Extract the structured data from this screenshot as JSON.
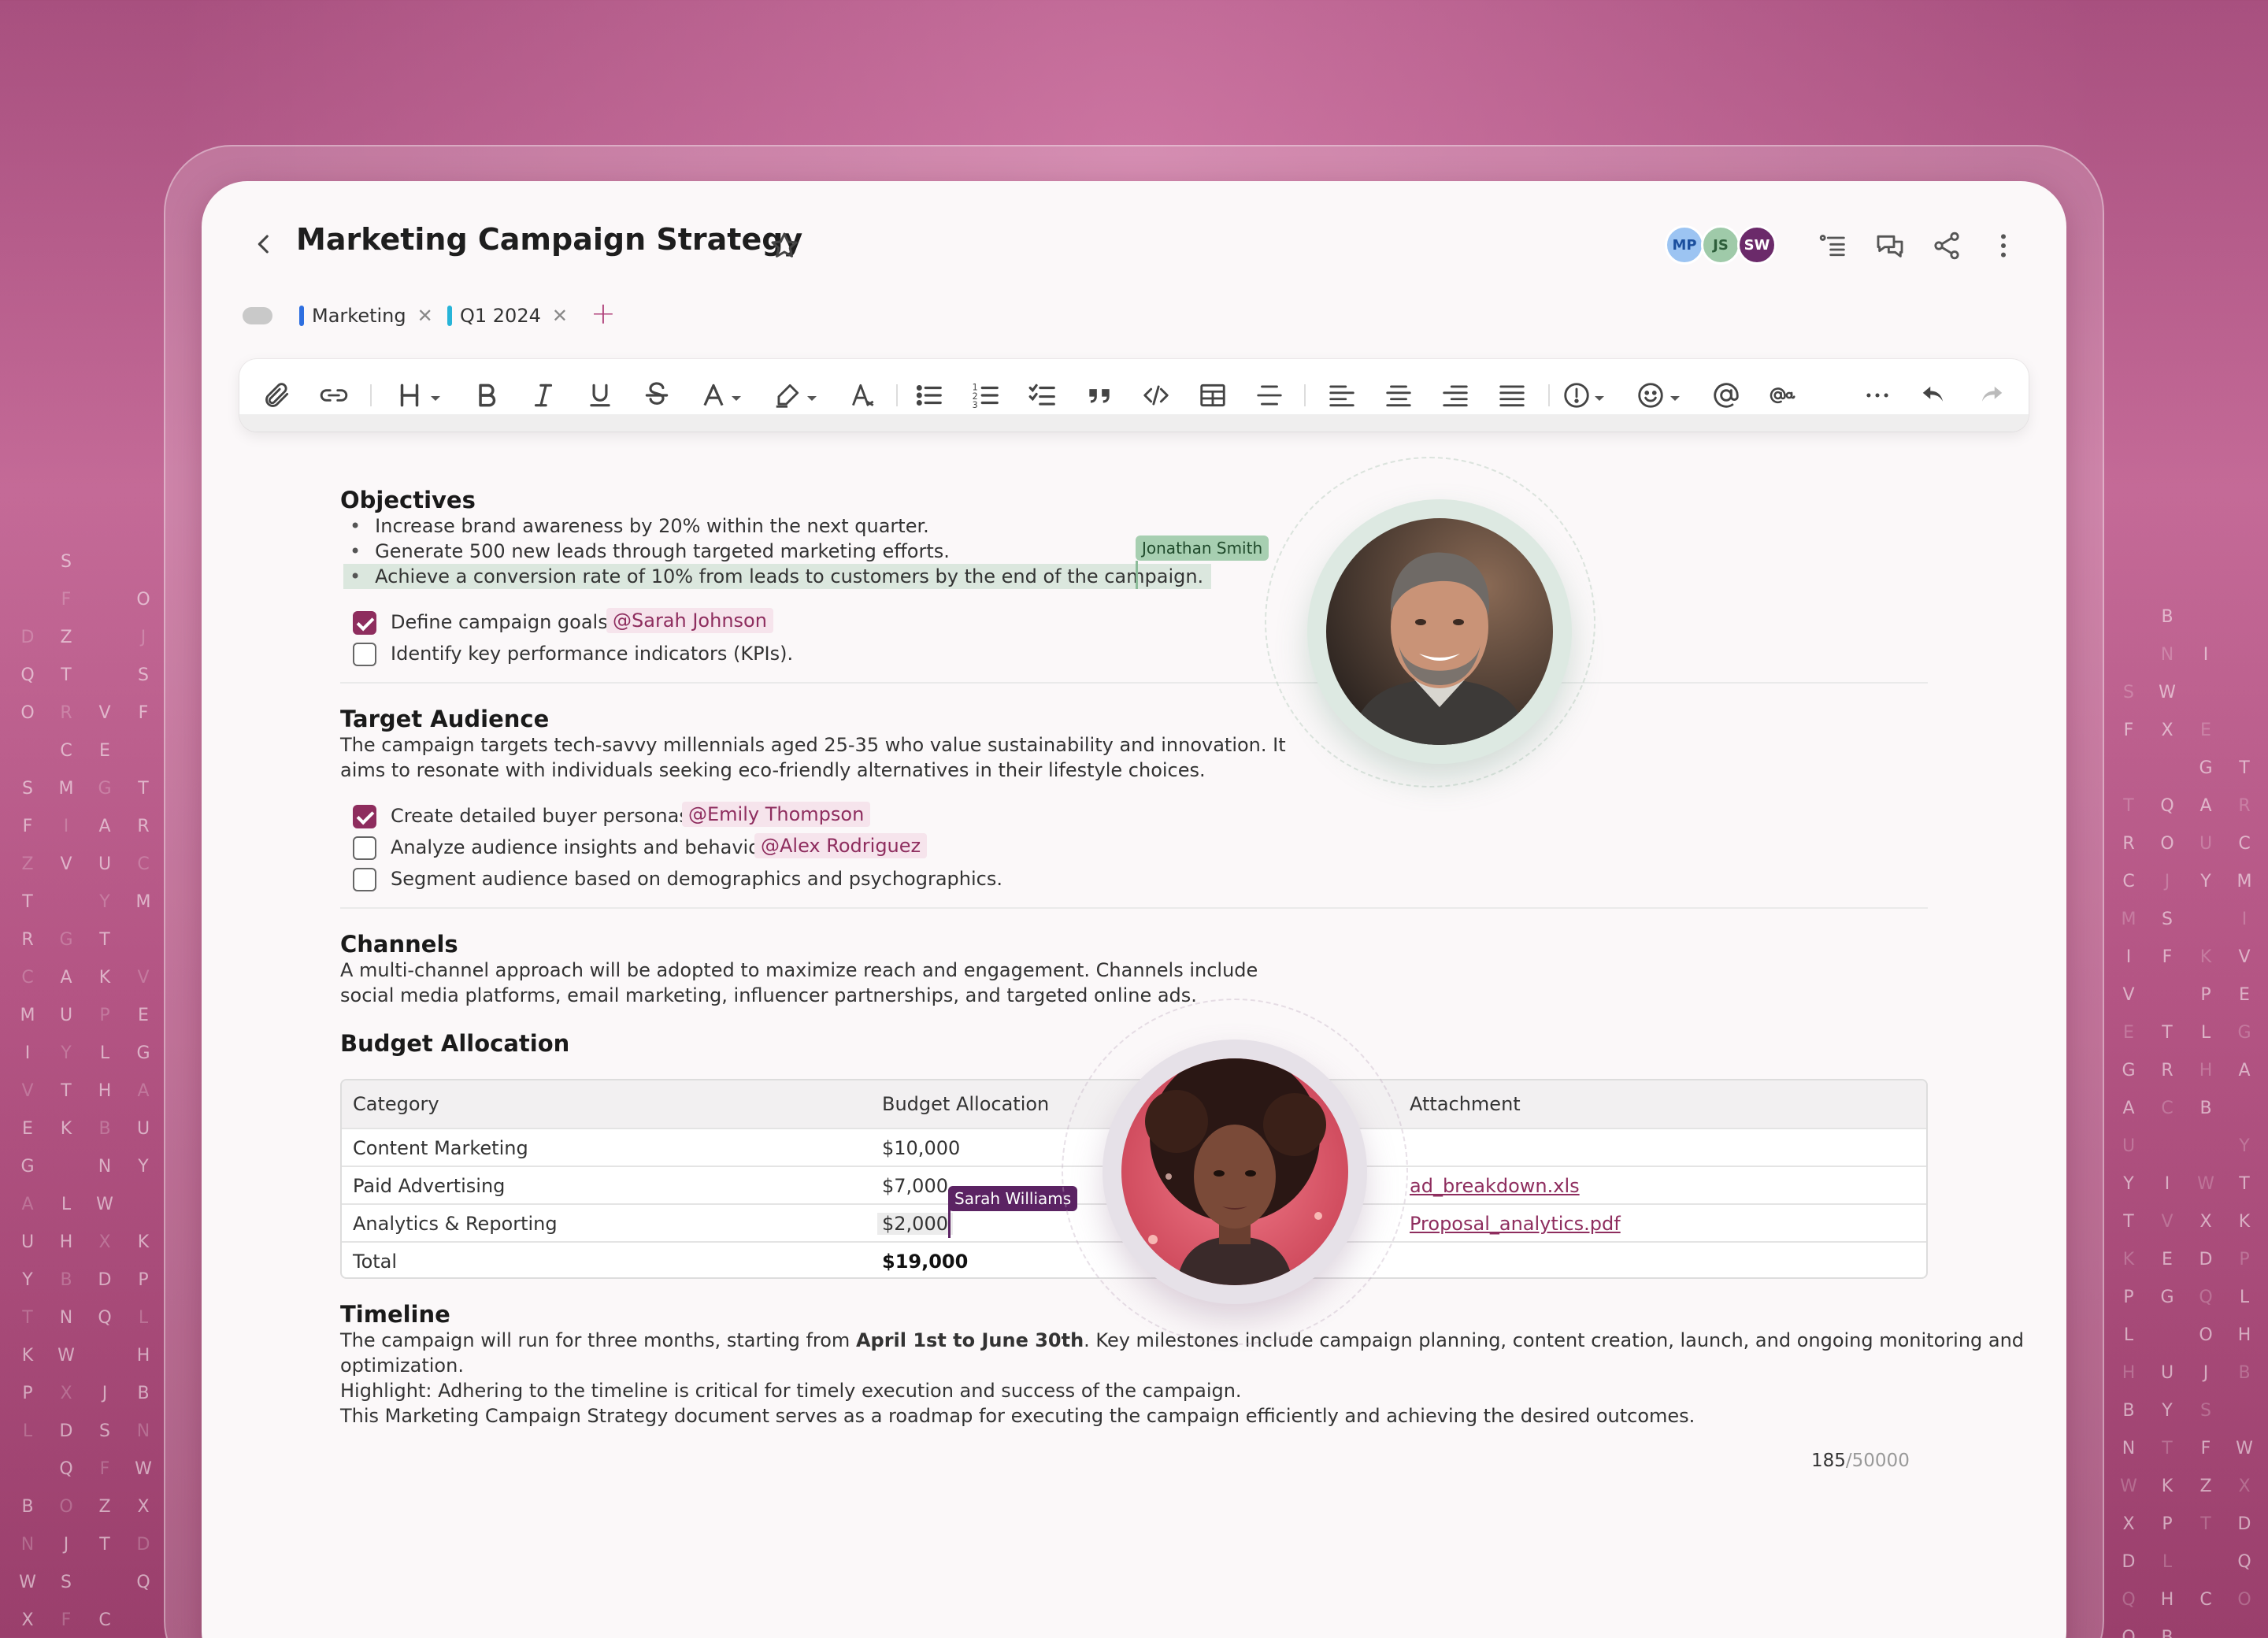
{
  "document": {
    "title": "Marketing Campaign Strategy",
    "collaborators": [
      "MP",
      "JS",
      "SW"
    ],
    "tags": [
      {
        "label": "Marketing",
        "color": "#2e6fe0"
      },
      {
        "label": "Q1 2024",
        "color": "#27b4d8"
      }
    ],
    "accent": "#8e2d5e"
  },
  "icons": {
    "back": "chevron-left-icon",
    "star": "star-icon",
    "outline": "outline-icon",
    "comments": "comments-icon",
    "share": "share-icon",
    "more": "more-vertical-icon"
  },
  "sections": {
    "objectives": {
      "title": "Objectives",
      "bullets": [
        "Increase brand awareness by 20% within the next quarter.",
        "Generate 500 new leads through targeted marketing efforts.",
        "Achieve a conversion rate of 10% from leads to customers by the end of the campaign."
      ],
      "cursor_user": "Jonathan Smith",
      "tasks": [
        {
          "text": "Define campaign goals.",
          "checked": true,
          "mention": "@Sarah Johnson"
        },
        {
          "text": "Identify key performance indicators (KPIs).",
          "checked": false,
          "mention": ""
        }
      ]
    },
    "audience": {
      "title": "Target Audience",
      "line1": "The campaign targets tech-savvy millennials aged 25-35 who value sustainability and innovation. It",
      "line2": "aims to resonate with individuals seeking eco-friendly alternatives in their lifestyle choices.",
      "tasks": [
        {
          "text": "Create detailed buyer personas.",
          "checked": true,
          "mention": "@Emily Thompson"
        },
        {
          "text": "Analyze audience insights and behavior.",
          "checked": false,
          "mention": "@Alex Rodriguez"
        },
        {
          "text": "Segment audience based on demographics and psychographics.",
          "checked": false,
          "mention": ""
        }
      ]
    },
    "channels": {
      "title": "Channels",
      "line1": "A multi-channel approach will be adopted to maximize reach and engagement. Channels include",
      "line2": "social media platforms, email marketing, influencer partnerships, and targeted online ads."
    },
    "budget": {
      "title": "Budget Allocation",
      "columns": [
        "Category",
        "Budget Allocation",
        "Attachment"
      ],
      "rows": [
        {
          "category": "Content Marketing",
          "amount": "$10,000",
          "attachment": ""
        },
        {
          "category": "Paid Advertising",
          "amount": "$7,000",
          "attachment": "ad_breakdown.xls"
        },
        {
          "category": "Analytics & Reporting",
          "amount": "$2,000",
          "attachment": "Proposal_analytics.pdf"
        },
        {
          "category": "Total",
          "amount": "$19,000",
          "attachment": ""
        }
      ],
      "cursor_user": "Sarah Williams"
    },
    "timeline": {
      "title": "Timeline",
      "line1_pre": "The campaign will run for three months, starting from ",
      "line1_bold": "April 1st to June 30th",
      "line1_post": ". Key milestones include campaign planning, content creation, launch, and ongoing monitoring and",
      "line2": "optimization.",
      "line3": "Highlight: Adhering to the timeline is critical for timely execution and success of the campaign.",
      "line4": "This Marketing Campaign Strategy document serves as a roadmap for executing the campaign efficiently and achieving the desired outcomes."
    }
  },
  "counter": {
    "current": "185",
    "max": "/50000"
  },
  "background_letters": {
    "left": [
      [
        "",
        "S",
        "",
        ""
      ],
      [
        "",
        "F",
        "",
        "O"
      ],
      [
        "D",
        "Z",
        "",
        "J"
      ],
      [
        "Q",
        "T",
        "",
        "S"
      ],
      [
        "O",
        "R",
        "V",
        "F"
      ],
      [
        "",
        "C",
        "E",
        ""
      ],
      [
        "S",
        "M",
        "G",
        "T"
      ],
      [
        "F",
        "I",
        "A",
        "R"
      ],
      [
        "Z",
        "V",
        "U",
        "C"
      ],
      [
        "T",
        "",
        "Y",
        "M"
      ],
      [
        "R",
        "G",
        "T",
        ""
      ],
      [
        "C",
        "A",
        "K",
        "V"
      ],
      [
        "M",
        "U",
        "P",
        "E"
      ],
      [
        "I",
        "Y",
        "L",
        "G"
      ],
      [
        "V",
        "T",
        "H",
        "A"
      ],
      [
        "E",
        "K",
        "B",
        "U"
      ],
      [
        "G",
        "",
        "N",
        "Y"
      ],
      [
        "A",
        "L",
        "W",
        ""
      ],
      [
        "U",
        "H",
        "X",
        "K"
      ],
      [
        "Y",
        "B",
        "D",
        "P"
      ],
      [
        "T",
        "N",
        "Q",
        "L"
      ],
      [
        "K",
        "W",
        "",
        "H"
      ],
      [
        "P",
        "X",
        "J",
        "B"
      ],
      [
        "L",
        "D",
        "S",
        "N"
      ],
      [
        "",
        "Q",
        "F",
        "W"
      ],
      [
        "B",
        "O",
        "Z",
        "X"
      ],
      [
        "N",
        "J",
        "T",
        "D"
      ],
      [
        "W",
        "S",
        "",
        "Q"
      ],
      [
        "X",
        "F",
        "C",
        ""
      ]
    ],
    "right": [
      [
        "",
        "B",
        "",
        ""
      ],
      [
        "",
        "N",
        "I",
        ""
      ],
      [
        "S",
        "W",
        "",
        ""
      ],
      [
        "F",
        "X",
        "E",
        ""
      ],
      [
        "",
        "",
        "G",
        "T"
      ],
      [
        "T",
        "Q",
        "A",
        "R"
      ],
      [
        "R",
        "O",
        "U",
        "C"
      ],
      [
        "C",
        "J",
        "Y",
        "M"
      ],
      [
        "M",
        "S",
        "",
        "I"
      ],
      [
        "I",
        "F",
        "K",
        "V"
      ],
      [
        "V",
        "",
        "P",
        "E"
      ],
      [
        "E",
        "T",
        "L",
        "G"
      ],
      [
        "G",
        "R",
        "H",
        "A"
      ],
      [
        "A",
        "C",
        "B",
        ""
      ],
      [
        "U",
        "",
        "",
        "Y"
      ],
      [
        "Y",
        "I",
        "W",
        "T"
      ],
      [
        "T",
        "V",
        "X",
        "K"
      ],
      [
        "K",
        "E",
        "D",
        "P"
      ],
      [
        "P",
        "G",
        "Q",
        "L"
      ],
      [
        "L",
        "",
        "O",
        "H"
      ],
      [
        "H",
        "U",
        "J",
        "B"
      ],
      [
        "B",
        "Y",
        "S",
        ""
      ],
      [
        "N",
        "T",
        "F",
        "W"
      ],
      [
        "W",
        "K",
        "Z",
        "X"
      ],
      [
        "X",
        "P",
        "T",
        "D"
      ],
      [
        "D",
        "L",
        "",
        "Q"
      ],
      [
        "Q",
        "H",
        "C",
        "O"
      ],
      [
        "O",
        "B",
        "",
        ""
      ]
    ]
  }
}
